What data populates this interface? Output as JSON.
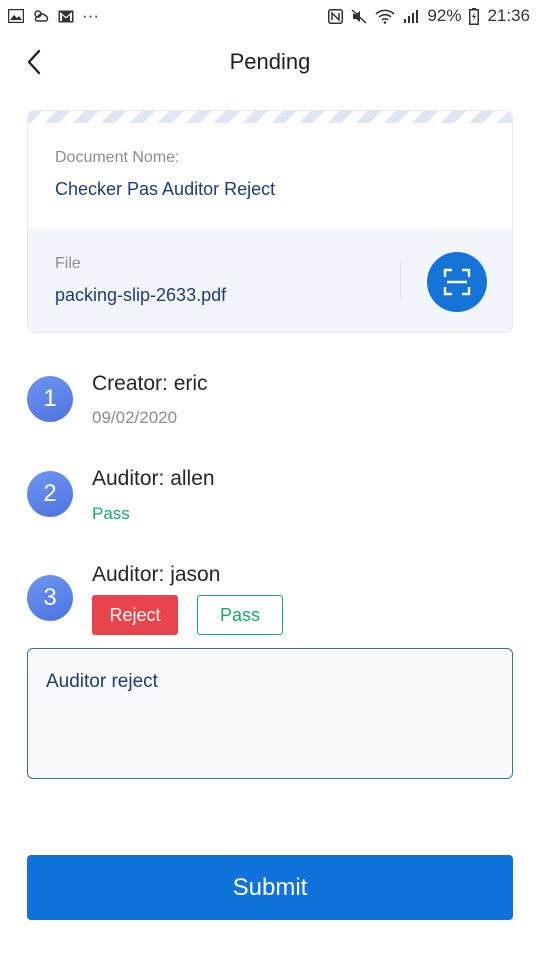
{
  "status_bar": {
    "battery": "92%",
    "time": "21:36",
    "more": "···"
  },
  "header": {
    "title": "Pending"
  },
  "document": {
    "name_label": "Document Nome:",
    "name_value": "Checker Pas Auditor Reject",
    "file_label": "File",
    "file_value": "packing-slip-2633.pdf"
  },
  "steps": [
    {
      "number": "1",
      "title": "Creator: eric",
      "detail": "09/02/2020"
    },
    {
      "number": "2",
      "title": "Auditor: allen",
      "detail": "Pass"
    },
    {
      "number": "3",
      "title": "Auditor: jason"
    }
  ],
  "actions": {
    "reject_label": "Reject",
    "pass_label": "Pass"
  },
  "comment": {
    "value": "Auditor reject"
  },
  "submit_label": "Submit",
  "colors": {
    "primary": "#0f73db",
    "reject": "#e9434b",
    "pass": "#1aa66a",
    "step_badge": "#5c82e8"
  }
}
